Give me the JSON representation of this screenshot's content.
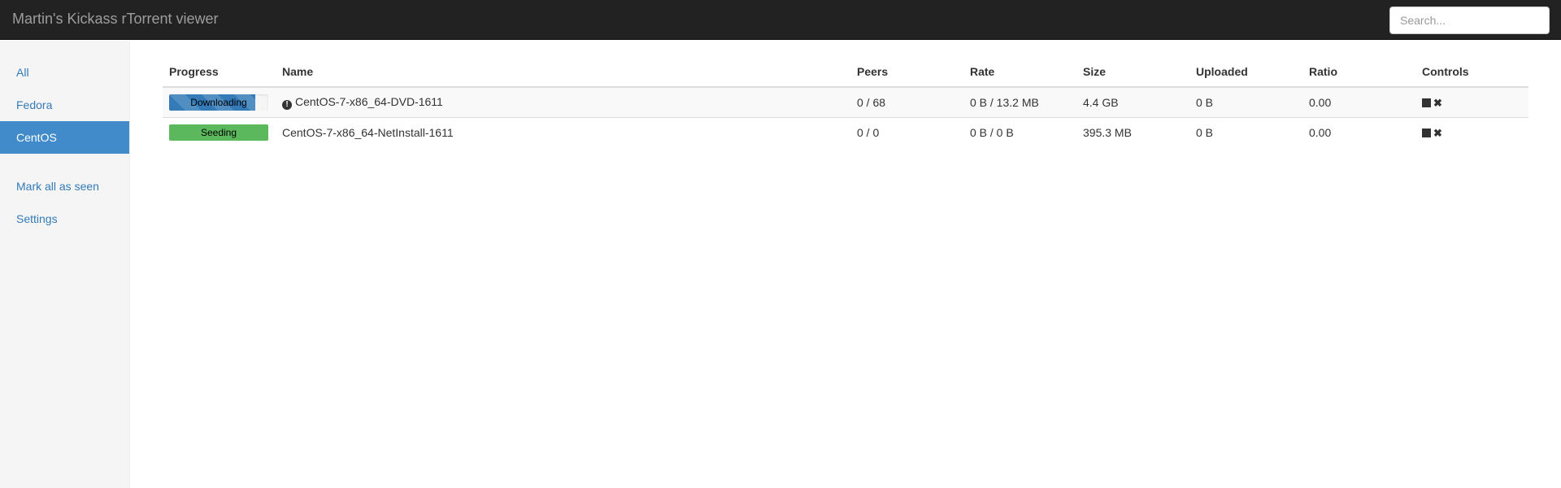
{
  "app": {
    "title": "Martin's Kickass rTorrent viewer"
  },
  "search": {
    "placeholder": "Search...",
    "value": ""
  },
  "sidebar": {
    "filters": [
      {
        "label": "All",
        "active": false
      },
      {
        "label": "Fedora",
        "active": false
      },
      {
        "label": "CentOS",
        "active": true
      }
    ],
    "actions": [
      {
        "label": "Mark all as seen"
      },
      {
        "label": "Settings"
      }
    ]
  },
  "table": {
    "columns": [
      "Progress",
      "Name",
      "Peers",
      "Rate",
      "Size",
      "Uploaded",
      "Ratio",
      "Controls"
    ],
    "rows": [
      {
        "status": "Downloading",
        "progress_fraction": 0.87,
        "bar_color": "#337ab7",
        "warning_icon": "exclamation-circle-icon",
        "name": "CentOS-7-x86_64-DVD-1611",
        "peers": "0 / 68",
        "rate": "0 B / 13.2 MB",
        "size": "4.4 GB",
        "uploaded": "0 B",
        "ratio": "0.00",
        "controls": [
          "stop-icon",
          "remove-icon"
        ]
      },
      {
        "status": "Seeding",
        "progress_fraction": 1.0,
        "bar_color": "#5cb85c",
        "warning_icon": "",
        "name": "CentOS-7-x86_64-NetInstall-1611",
        "peers": "0 / 0",
        "rate": "0 B / 0 B",
        "size": "395.3 MB",
        "uploaded": "0 B",
        "ratio": "0.00",
        "controls": [
          "stop-icon",
          "remove-icon"
        ]
      }
    ]
  },
  "colors": {
    "navbar": "#222222",
    "accent": "#428bca",
    "link": "#337ab7",
    "success": "#5cb85c"
  }
}
